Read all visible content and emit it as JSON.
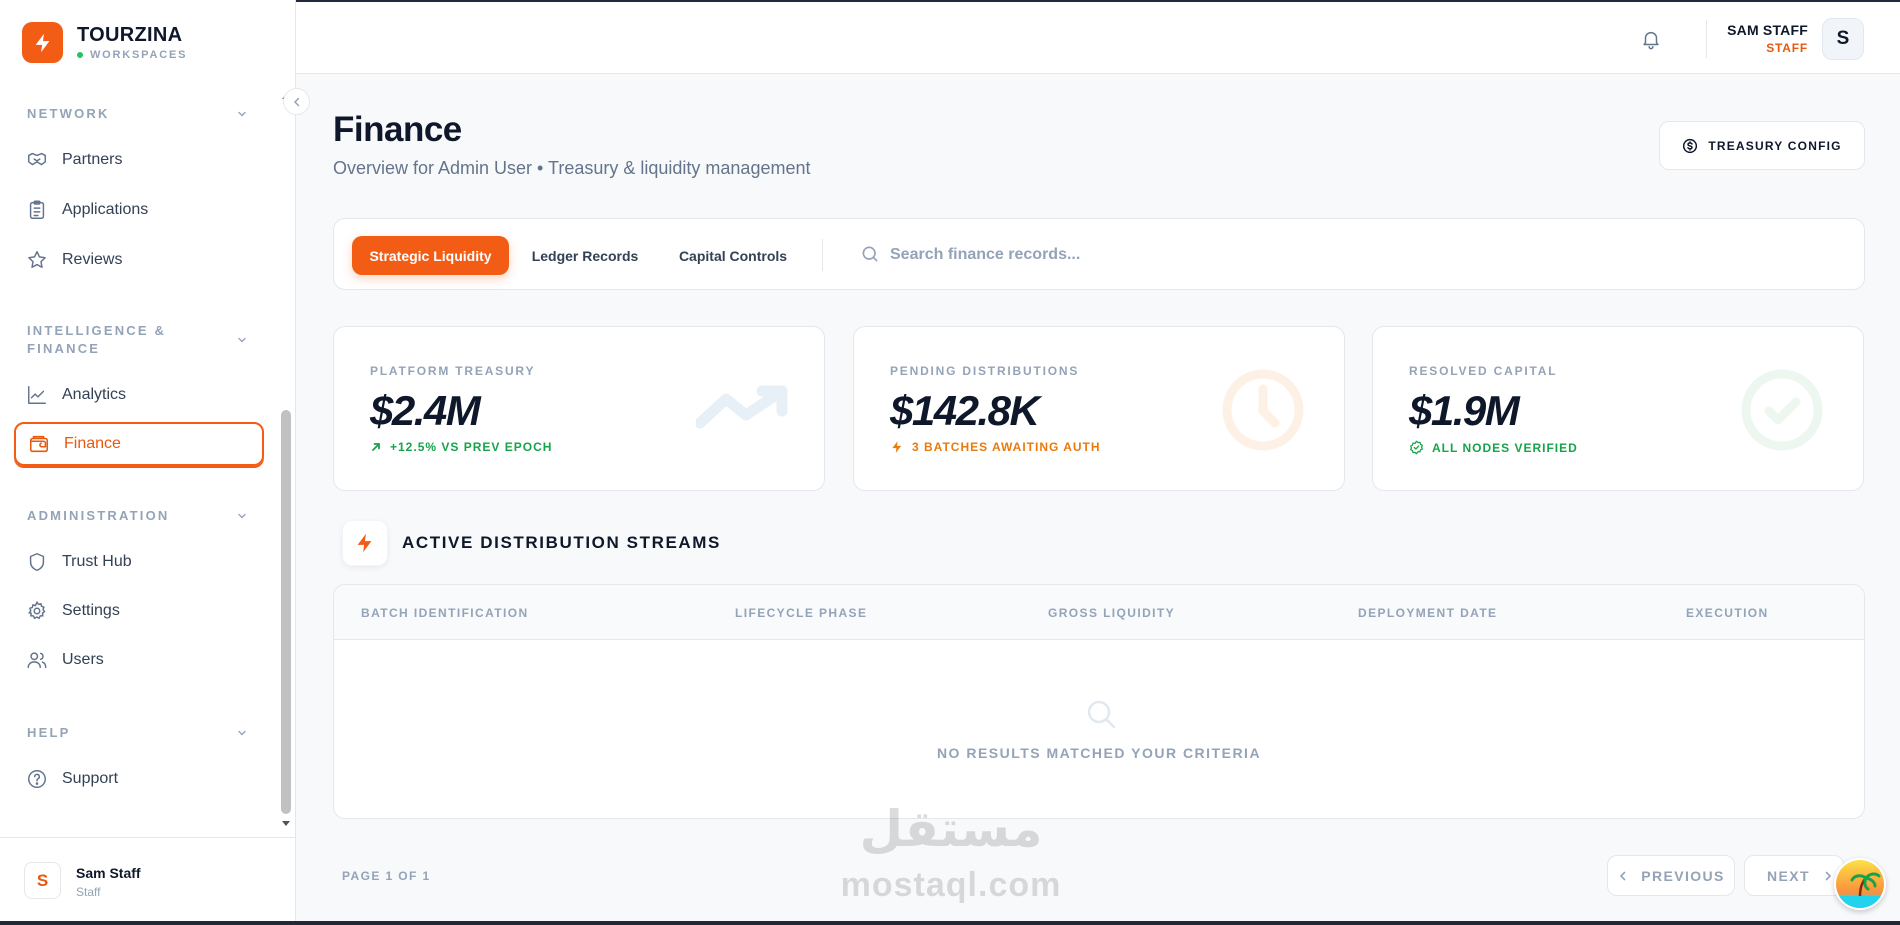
{
  "brand": {
    "name": "TOURZINA",
    "sub": "WORKSPACES"
  },
  "nav": {
    "sections": [
      {
        "title": "NETWORK"
      },
      {
        "title_line1": "INTELLIGENCE &",
        "title_line2": "FINANCE"
      },
      {
        "title": "ADMINISTRATION"
      },
      {
        "title": "HELP"
      }
    ],
    "items": {
      "partners": "Partners",
      "applications": "Applications",
      "reviews": "Reviews",
      "analytics": "Analytics",
      "finance": "Finance",
      "trust_hub": "Trust Hub",
      "settings": "Settings",
      "users": "Users",
      "support": "Support"
    }
  },
  "sidebar_user": {
    "initial": "S",
    "name": "Sam Staff",
    "role": "Staff"
  },
  "topbar": {
    "user_name": "SAM STAFF",
    "user_role": "STAFF",
    "avatar_initial": "S"
  },
  "page": {
    "title": "Finance",
    "subtitle": "Overview for Admin User • Treasury & liquidity management",
    "treasury_button": "TREASURY CONFIG"
  },
  "tabs": [
    "Strategic Liquidity",
    "Ledger Records",
    "Capital Controls"
  ],
  "search": {
    "placeholder": "Search finance records..."
  },
  "stats": [
    {
      "label": "PLATFORM TREASURY",
      "value": "$2.4M",
      "note": "+12.5% VS PREV EPOCH",
      "note_color": "#16a34a"
    },
    {
      "label": "PENDING DISTRIBUTIONS",
      "value": "$142.8K",
      "note": "3 BATCHES AWAITING AUTH",
      "note_color": "#ea7a0c"
    },
    {
      "label": "RESOLVED CAPITAL",
      "value": "$1.9M",
      "note": "ALL NODES VERIFIED",
      "note_color": "#16a34a"
    }
  ],
  "section": {
    "title": "ACTIVE DISTRIBUTION STREAMS"
  },
  "table": {
    "columns": [
      "BATCH IDENTIFICATION",
      "LIFECYCLE PHASE",
      "GROSS LIQUIDITY",
      "DEPLOYMENT DATE",
      "EXECUTION"
    ],
    "empty_message": "NO RESULTS MATCHED YOUR CRITERIA"
  },
  "pagination": {
    "indicator": "PAGE 1 OF 1",
    "previous": "PREVIOUS",
    "next": "NEXT"
  },
  "watermark": {
    "arabic": "مستقل",
    "latin": "mostaql.com"
  },
  "colors": {
    "accent": "#f25c14",
    "success": "#16a34a",
    "warning": "#ea7a0c",
    "muted": "#94a3b8"
  }
}
